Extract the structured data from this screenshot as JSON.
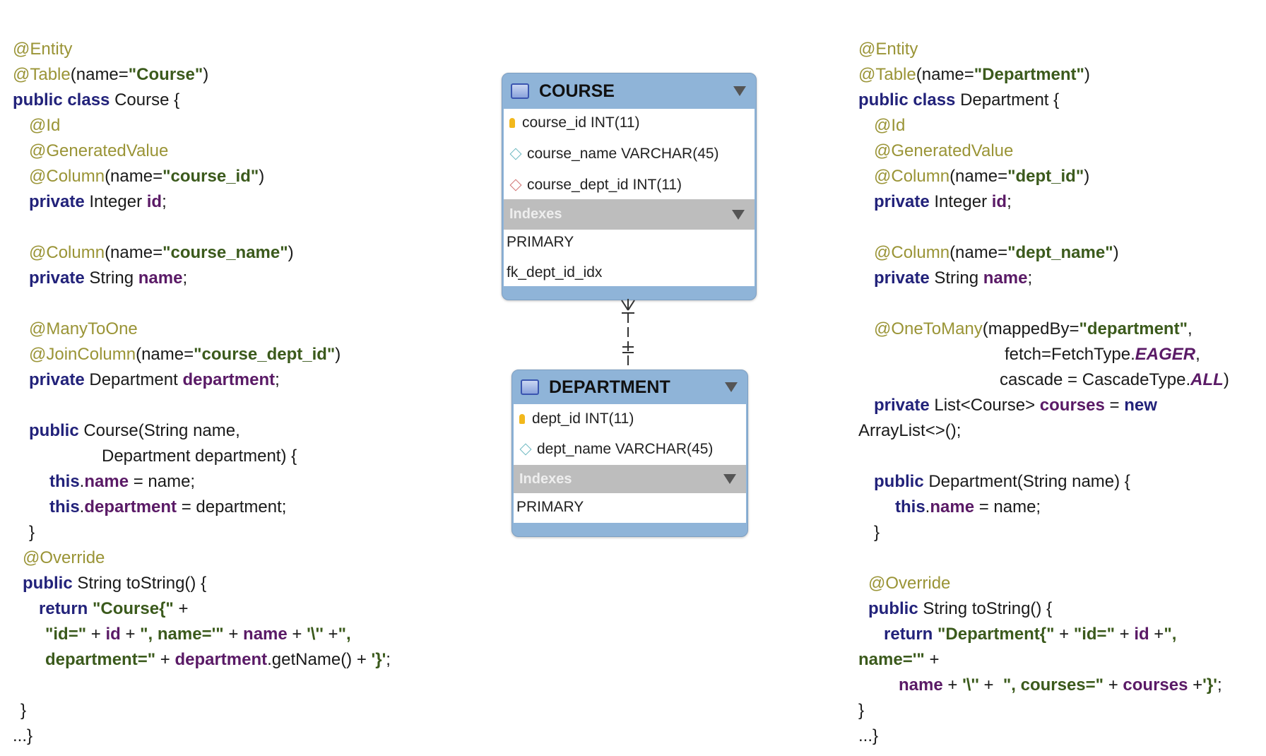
{
  "left_code": [
    [
      [
        "ann",
        "@Entity"
      ]
    ],
    [
      [
        "ann",
        "@Table"
      ],
      [
        "txt",
        "(name="
      ],
      [
        "str",
        "\"Course\""
      ],
      [
        "txt",
        ")"
      ]
    ],
    [
      [
        "kw",
        "public class "
      ],
      [
        "txt",
        "Course {"
      ]
    ],
    [
      [
        "ann",
        "@Id"
      ]
    ],
    [
      [
        "ann",
        "@GeneratedValue"
      ]
    ],
    [
      [
        "ann",
        "@Column"
      ],
      [
        "txt",
        "(name="
      ],
      [
        "str",
        "\"course_id\""
      ],
      [
        "txt",
        ")"
      ]
    ],
    [
      [
        "kw",
        "private "
      ],
      [
        "txt",
        "Integer "
      ],
      [
        "fld",
        "id"
      ],
      [
        "txt",
        ";"
      ]
    ],
    [],
    [
      [
        "ann",
        "@Column"
      ],
      [
        "txt",
        "(name="
      ],
      [
        "str",
        "\"course_name\""
      ],
      [
        "txt",
        ")"
      ]
    ],
    [
      [
        "kw",
        "private "
      ],
      [
        "txt",
        "String "
      ],
      [
        "fld",
        "name"
      ],
      [
        "txt",
        ";"
      ]
    ],
    [],
    [
      [
        "ann",
        "@ManyToOne"
      ]
    ],
    [
      [
        "ann",
        "@JoinColumn"
      ],
      [
        "txt",
        "(name="
      ],
      [
        "str",
        "\"course_dept_id\""
      ],
      [
        "txt",
        ")"
      ]
    ],
    [
      [
        "kw",
        "private "
      ],
      [
        "txt",
        "Department "
      ],
      [
        "fld",
        "department"
      ],
      [
        "txt",
        ";"
      ]
    ],
    [],
    [
      [
        "kw",
        "public "
      ],
      [
        "txt",
        "Course(String name,"
      ]
    ],
    [
      [
        "txt",
        "Department department) {"
      ]
    ],
    [
      [
        "kw",
        "this"
      ],
      [
        "txt",
        "."
      ],
      [
        "fld",
        "name"
      ],
      [
        "txt",
        " = name;"
      ]
    ],
    [
      [
        "kw",
        "this"
      ],
      [
        "txt",
        "."
      ],
      [
        "fld",
        "department"
      ],
      [
        "txt",
        " = department;"
      ]
    ],
    [
      [
        "txt",
        "}"
      ]
    ],
    [
      [
        "ann",
        "@Override"
      ]
    ],
    [
      [
        "kw",
        "public "
      ],
      [
        "txt",
        "String toString() {"
      ]
    ],
    [
      [
        "kw",
        "return "
      ],
      [
        "str",
        "\"Course{\""
      ],
      [
        "txt",
        " +"
      ]
    ],
    [
      [
        "str",
        "\"id=\""
      ],
      [
        "txt",
        " + "
      ],
      [
        "fld",
        "id"
      ],
      [
        "txt",
        " + "
      ],
      [
        "str",
        "\", name='\""
      ],
      [
        "txt",
        " + "
      ],
      [
        "fld",
        "name"
      ],
      [
        "txt",
        " + "
      ],
      [
        "str",
        "'\\''"
      ],
      [
        "txt",
        " +"
      ],
      [
        "str",
        "\","
      ]
    ],
    [
      [
        "str",
        "department=\""
      ],
      [
        "txt",
        " + "
      ],
      [
        "fld",
        "department"
      ],
      [
        "txt",
        ".getName() + "
      ],
      [
        "str",
        "'}'"
      ],
      [
        "txt",
        ";"
      ]
    ],
    [],
    [
      [
        "txt",
        "}"
      ]
    ],
    [
      [
        "txt",
        "...}"
      ]
    ]
  ],
  "right_code": [
    [
      [
        "ann",
        "@Entity"
      ]
    ],
    [
      [
        "ann",
        "@Table"
      ],
      [
        "txt",
        "(name="
      ],
      [
        "str",
        "\"Department\""
      ],
      [
        "txt",
        ")"
      ]
    ],
    [
      [
        "kw",
        "public class "
      ],
      [
        "txt",
        "Department {"
      ]
    ],
    [
      [
        "ann",
        "@Id"
      ]
    ],
    [
      [
        "ann",
        "@GeneratedValue"
      ]
    ],
    [
      [
        "ann",
        "@Column"
      ],
      [
        "txt",
        "(name="
      ],
      [
        "str",
        "\"dept_id\""
      ],
      [
        "txt",
        ")"
      ]
    ],
    [
      [
        "kw",
        "private "
      ],
      [
        "txt",
        "Integer "
      ],
      [
        "fld",
        "id"
      ],
      [
        "txt",
        ";"
      ]
    ],
    [],
    [
      [
        "ann",
        "@Column"
      ],
      [
        "txt",
        "(name="
      ],
      [
        "str",
        "\"dept_name\""
      ],
      [
        "txt",
        ")"
      ]
    ],
    [
      [
        "kw",
        "private "
      ],
      [
        "txt",
        "String "
      ],
      [
        "fld",
        "name"
      ],
      [
        "txt",
        ";"
      ]
    ],
    [],
    [
      [
        "ann",
        "@OneToMany"
      ],
      [
        "txt",
        "(mappedBy="
      ],
      [
        "str",
        "\"department\""
      ],
      [
        "txt",
        ","
      ]
    ],
    [
      [
        "txt",
        "fetch=FetchType."
      ],
      [
        "const",
        "EAGER"
      ],
      [
        "txt",
        ","
      ]
    ],
    [
      [
        "txt",
        "cascade = CascadeType."
      ],
      [
        "const",
        "ALL"
      ],
      [
        "txt",
        ")"
      ]
    ],
    [
      [
        "kw",
        "private "
      ],
      [
        "txt",
        "List<Course> "
      ],
      [
        "fld",
        "courses"
      ],
      [
        "txt",
        " = "
      ],
      [
        "kw",
        "new"
      ]
    ],
    [
      [
        "txt",
        "ArrayList<>();"
      ]
    ],
    [],
    [
      [
        "kw",
        "public "
      ],
      [
        "txt",
        "Department(String name) {"
      ]
    ],
    [
      [
        "kw",
        "this"
      ],
      [
        "txt",
        "."
      ],
      [
        "fld",
        "name"
      ],
      [
        "txt",
        " = name;"
      ]
    ],
    [
      [
        "txt",
        "}"
      ]
    ],
    [],
    [
      [
        "ann",
        "@Override"
      ]
    ],
    [
      [
        "kw",
        "public "
      ],
      [
        "txt",
        "String toString() {"
      ]
    ],
    [
      [
        "kw",
        "return "
      ],
      [
        "str",
        "\"Department{\""
      ],
      [
        "txt",
        " + "
      ],
      [
        "str",
        "\"id=\""
      ],
      [
        "txt",
        " + "
      ],
      [
        "fld",
        "id"
      ],
      [
        "txt",
        " +"
      ],
      [
        "str",
        "\","
      ]
    ],
    [
      [
        "str",
        "name='\""
      ],
      [
        "txt",
        " +"
      ]
    ],
    [
      [
        "fld",
        "name"
      ],
      [
        "txt",
        " + "
      ],
      [
        "str",
        "'\\''"
      ],
      [
        "txt",
        " +  "
      ],
      [
        "str",
        "\", courses=\""
      ],
      [
        "txt",
        " + "
      ],
      [
        "fld",
        "courses"
      ],
      [
        "txt",
        " +"
      ],
      [
        "str",
        "'}'"
      ],
      [
        "txt",
        ";"
      ]
    ],
    [
      [
        "txt",
        "}"
      ]
    ],
    [
      [
        "txt",
        "...}"
      ]
    ]
  ],
  "er": {
    "course": {
      "title": "COURSE",
      "columns": [
        {
          "icon": "primary-key-icon",
          "text": "course_id INT(11)"
        },
        {
          "icon": "column-diamond-icon",
          "text": "course_name VARCHAR(45)"
        },
        {
          "icon": "foreign-key-diamond-icon",
          "text": "course_dept_id INT(11)"
        }
      ],
      "indexes_label": "Indexes",
      "indexes": [
        "PRIMARY",
        "fk_dept_id_idx"
      ]
    },
    "department": {
      "title": "DEPARTMENT",
      "columns": [
        {
          "icon": "primary-key-icon",
          "text": "dept_id INT(11)"
        },
        {
          "icon": "column-diamond-icon",
          "text": "dept_name VARCHAR(45)"
        }
      ],
      "indexes_label": "Indexes",
      "indexes": [
        "PRIMARY"
      ]
    },
    "relationship": "many-to-one"
  },
  "colors": {
    "annotation": "#9a9436",
    "keyword": "#22227a",
    "string": "#3b5a1c",
    "field": "#5a1a66",
    "table_header": "#8fb4d8"
  }
}
